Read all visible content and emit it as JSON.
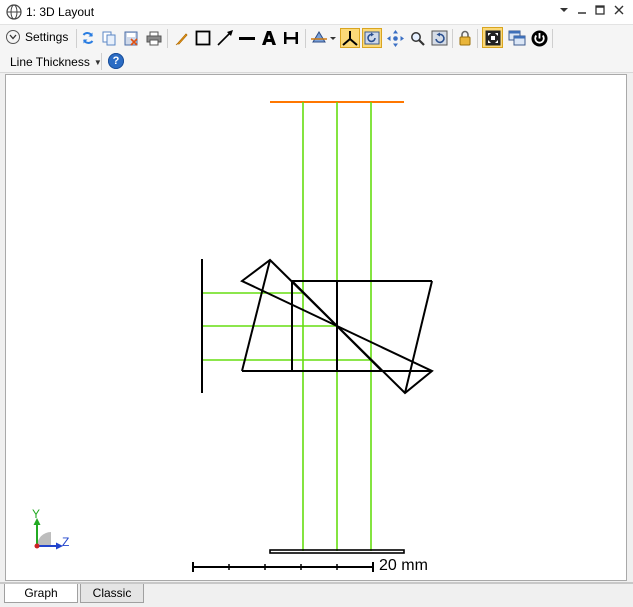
{
  "window": {
    "title": "1: 3D Layout",
    "controls": [
      "chevron-down-icon",
      "minimize-icon",
      "maximize-icon",
      "close-icon"
    ]
  },
  "toolbar": {
    "settings_label": "Settings",
    "line_thickness_label": "Line Thickness",
    "tools": [
      "refresh-icon",
      "copy-icon",
      "save-icon",
      "print-icon",
      "pencil-icon",
      "rectangle-icon",
      "arrow-icon",
      "line-icon",
      "text-icon",
      "dimension-icon",
      "rotate-3d-icon",
      "axes-icon",
      "reset-view-icon",
      "pan-icon",
      "zoom-icon",
      "undo-view-icon",
      "lock-icon",
      "fit-to-window-icon",
      "windows-icon",
      "power-icon"
    ],
    "active_tools": [
      "axes-icon",
      "reset-view-icon",
      "fit-to-window-icon"
    ]
  },
  "layout": {
    "scale_bar_label": "20 mm",
    "axis_labels": {
      "y": "Y",
      "z": "Z"
    },
    "colors": {
      "rays": "#66dd11",
      "detector": "#ff7700",
      "surfaces": "#000000",
      "axis_y": "#22aa22",
      "axis_z": "#2244cc",
      "axis_origin": "#cc2222"
    }
  },
  "tabs": [
    {
      "label": "Graph",
      "active": true
    },
    {
      "label": "Classic",
      "active": false
    }
  ]
}
